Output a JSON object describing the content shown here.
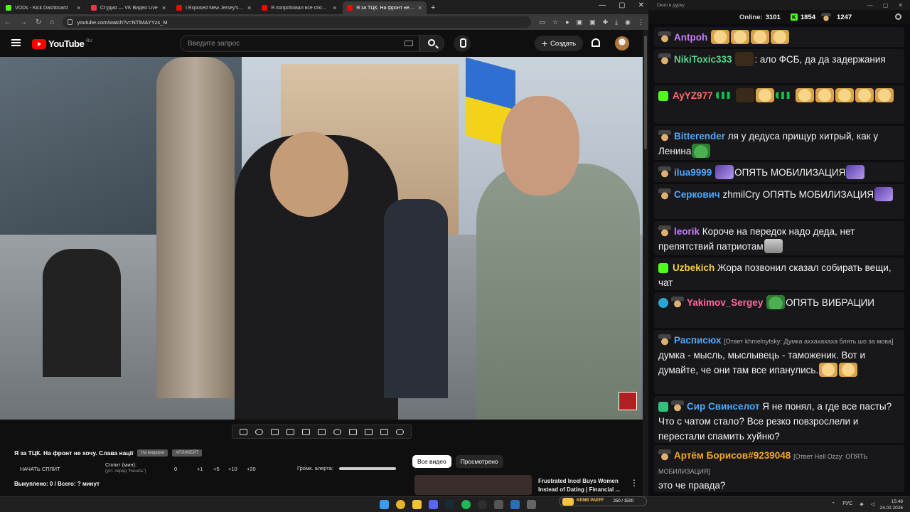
{
  "browser": {
    "tabs": [
      {
        "label": "VODs - Kick Dashboard",
        "color": "#53fc18",
        "active": false
      },
      {
        "label": "Студия — VK Видео Live",
        "color": "#e63946",
        "active": false
      },
      {
        "label": "I Exposed New Jersey's Jewish ...",
        "color": "#ff0000",
        "active": false
      },
      {
        "label": "Я попробовал все способы б...",
        "color": "#ff0000",
        "active": false
      },
      {
        "label": "Я за ТЦК. На фронт не хочу. С...",
        "color": "#ff0000",
        "active": true
      }
    ],
    "url": "youtube.com/watch?v=NTlMAYYzs_M"
  },
  "youtube": {
    "logo_text": "YouTube",
    "region": "RU",
    "search_placeholder": "Введите запрос",
    "create_label": "Создать"
  },
  "video": {
    "title": "Я за ТЦК. На фронт не хочу. Слава нації",
    "chip1": "На модерке",
    "chip2": "АПЛИКЕЙТ",
    "split_button": "НАЧАТЬ СПЛИТ",
    "split_label": "Сплит (мин):",
    "split_hint": "(уст. перед \"Начать\")",
    "split_value": "0",
    "split_steps": [
      "+1",
      "+5",
      "+10",
      "+20"
    ],
    "bought": "Выкуплено: 0 / Всего: ? минут",
    "volume_label": "Громк. алерта:",
    "tab_all": "Все видео",
    "tab_watched": "Просмотрено",
    "rec_title": "Frustrated Incel Buys Women Instead of Dating | Financial ..."
  },
  "chat": {
    "window_title": "Окно в дурку",
    "online_label": "Online:",
    "online": "3101",
    "kick_count": "1854",
    "other_count": "1247",
    "messages": [
      {
        "user": "Antpoh",
        "color": "#c77dff",
        "text": ""
      },
      {
        "user": "NikiToxic333",
        "color": "#58d68d",
        "text": ": ало ФСБ, да да задержания"
      },
      {
        "user": "AyYZ977",
        "color": "#ff6b6b",
        "text": ""
      },
      {
        "user": "Bitterender",
        "color": "#4ea8ff",
        "text": "ля у дедуса прищур хитрый, как у Ленина"
      },
      {
        "user": "ilua9999",
        "color": "#4ea8ff",
        "text": "ОПЯТЬ МОБИЛИЗАЦИЯ"
      },
      {
        "user": "Серкович",
        "color": "#4ea8ff",
        "text": "zhmilCry ОПЯТЬ МОБИЛИЗАЦИЯ"
      },
      {
        "user": "leorik",
        "color": "#c77dff",
        "text": "Короче на передок надо деда, нет препятствий патриотам"
      },
      {
        "user": "Uzbekich",
        "color": "#f4d03f",
        "text": "Жора позвонил сказал собирать вещи, чат"
      },
      {
        "user": "Yakimov_Sergey",
        "color": "#ff6b9d",
        "text": "ОПЯТЬ ВИБРАЦИИ"
      },
      {
        "user": "Расписюх",
        "color": "#4ea8ff",
        "reply": "[Ответ khmelnytsky: Думка аххахахаха блять шо за мова]",
        "text": "думка - мысль, мыслывець - таможеник. Вот и думайте, че они там все ипанулись."
      },
      {
        "user": "Сир Свинселот",
        "color": "#4ea8ff",
        "text": "Я не понял, а где все пасты? Что с чатом стало? Все резко повзрослели и перестали спамить хуйню?"
      },
      {
        "user": "Артём Борисов#9239048",
        "color": "#f5a623",
        "reply": "[Ответ Hell Ozzy: ОПЯТЬ МОБИЛИЗАЦИЯ]",
        "text": "это че правда?"
      }
    ]
  },
  "taskbar": {
    "kick_pill": "250 / 1500",
    "kick_label": "KEMB PAEFF",
    "lang": "РУС",
    "time": "15:48",
    "date": "24.02.2026"
  }
}
